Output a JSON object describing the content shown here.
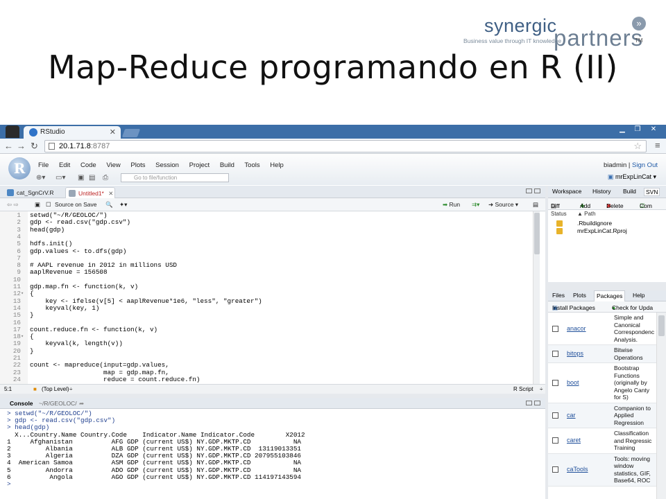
{
  "slide": {
    "title": "Map-Reduce programando en R (II)",
    "logo": {
      "word1": "synergic",
      "word2": "partners",
      "tagline": "Business value through IT knowledge",
      "tm": "TM"
    }
  },
  "browser": {
    "tab_title": "RStudio",
    "url_host": "20.1.71.8",
    "url_port": ":8787"
  },
  "rstudio": {
    "menu": [
      "File",
      "Edit",
      "Code",
      "View",
      "Plots",
      "Session",
      "Project",
      "Build",
      "Tools",
      "Help"
    ],
    "user": "biadmin",
    "sign_out": "Sign Out",
    "project": "mrExpLinCat",
    "goto_placeholder": "Go to file/function",
    "editor_tabs": [
      "cat_SgnCrV.R",
      "Untitled1*"
    ],
    "editor_toolbar": {
      "source_on_save": "Source on Save",
      "run": "Run",
      "source": "Source"
    },
    "code_lines": [
      {
        "n": "1",
        "t": "setwd(\"~/R/GEOLOC/\")"
      },
      {
        "n": "2",
        "t": "gdp <- read.csv(\"gdp.csv\")"
      },
      {
        "n": "3",
        "t": "head(gdp)"
      },
      {
        "n": "4",
        "t": ""
      },
      {
        "n": "5",
        "t": "hdfs.init()"
      },
      {
        "n": "6",
        "t": "gdp.values <- to.dfs(gdp)"
      },
      {
        "n": "7",
        "t": ""
      },
      {
        "n": "8",
        "t": "# AAPL revenue in 2012 in millions USD"
      },
      {
        "n": "9",
        "t": "aaplRevenue = 156508"
      },
      {
        "n": "10",
        "t": ""
      },
      {
        "n": "11",
        "t": "gdp.map.fn <- function(k, v)"
      },
      {
        "n": "12",
        "t": "{",
        "fold": true
      },
      {
        "n": "13",
        "t": "    key <- ifelse(v[5] < aaplRevenue*1e6, \"less\", \"greater\")"
      },
      {
        "n": "14",
        "t": "    keyval(key, 1)"
      },
      {
        "n": "15",
        "t": "}"
      },
      {
        "n": "16",
        "t": ""
      },
      {
        "n": "17",
        "t": "count.reduce.fn <- function(k, v)"
      },
      {
        "n": "18",
        "t": "{",
        "fold": true
      },
      {
        "n": "19",
        "t": "    keyval(k, length(v))"
      },
      {
        "n": "20",
        "t": "}"
      },
      {
        "n": "21",
        "t": ""
      },
      {
        "n": "22",
        "t": "count <- mapreduce(input=gdp.values,"
      },
      {
        "n": "23",
        "t": "                   map = gdp.map.fn,"
      },
      {
        "n": "24",
        "t": "                   reduce = count.reduce.fn)"
      }
    ],
    "status_bar": {
      "position": "5:1",
      "scope": "(Top Level)",
      "type": "R Script"
    },
    "console_title": "Console",
    "console_path": "~/R/GEOLOC/",
    "console_lines": [
      {
        "t": "> setwd(\"~/R/GEOLOC/\")",
        "in": true
      },
      {
        "t": "> gdp <- read.csv(\"gdp.csv\")",
        "in": true
      },
      {
        "t": "> head(gdp)",
        "in": true
      },
      {
        "t": "  X...Country.Name Country.Code    Indicator.Name Indicator.Code        X2012"
      },
      {
        "t": "1     Afghanistan          AFG GDP (current US$) NY.GDP.MKTP.CD           NA"
      },
      {
        "t": "2         Albania          ALB GDP (current US$) NY.GDP.MKTP.CD  13119013351"
      },
      {
        "t": "3         Algeria          DZA GDP (current US$) NY.GDP.MKTP.CD 207955103846"
      },
      {
        "t": "4  American Samoa          ASM GDP (current US$) NY.GDP.MKTP.CD           NA"
      },
      {
        "t": "5         Andorra          ADO GDP (current US$) NY.GDP.MKTP.CD           NA"
      },
      {
        "t": "6          Angola          AGO GDP (current US$) NY.GDP.MKTP.CD 114197143594"
      },
      {
        "t": ">",
        "in": true
      }
    ],
    "ws_tabs": [
      "Workspace",
      "History",
      "Build",
      "SVN"
    ],
    "ws_toolbar": [
      "Diff",
      "Add",
      "Delete",
      "Com"
    ],
    "ws_headers": [
      "Status",
      "Path"
    ],
    "ws_files": [
      ".Rbuildignore",
      "mrExpLinCat.Rproj"
    ],
    "pk_tabs": [
      "Files",
      "Plots",
      "Packages",
      "Help"
    ],
    "pk_toolbar": {
      "install": "Install Packages",
      "check": "Check for Upda"
    },
    "packages": [
      {
        "name": "anacor",
        "desc": [
          "Simple and",
          "Canonical",
          "Correspondenc",
          "Analysis."
        ]
      },
      {
        "name": "bitops",
        "desc": [
          "Bitwise",
          "Operations"
        ]
      },
      {
        "name": "boot",
        "desc": [
          "Bootstrap",
          "Functions",
          "(originally by",
          "Angelo Canty",
          "for S)"
        ]
      },
      {
        "name": "car",
        "desc": [
          "Companion to",
          "Applied",
          "Regression"
        ]
      },
      {
        "name": "caret",
        "desc": [
          "Classification",
          "and Regressic",
          "Training"
        ]
      },
      {
        "name": "caTools",
        "desc": [
          "Tools: moving",
          "window",
          "statistics, GIF,",
          "Base64, ROC"
        ]
      }
    ]
  }
}
